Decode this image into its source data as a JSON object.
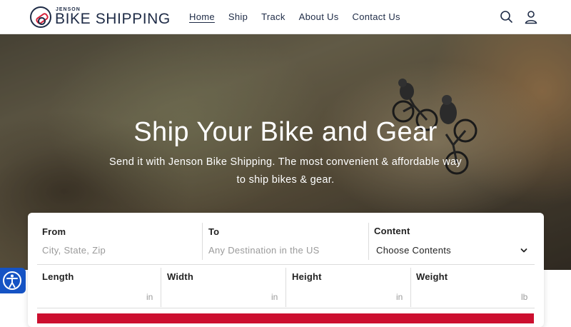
{
  "header": {
    "logo_small": "JENSON",
    "logo_big": "BIKE SHIPPING",
    "nav": [
      {
        "label": "Home",
        "active": true
      },
      {
        "label": "Ship"
      },
      {
        "label": "Track"
      },
      {
        "label": "About Us"
      },
      {
        "label": "Contact Us"
      }
    ],
    "icons": [
      "search-icon",
      "account-icon"
    ]
  },
  "hero": {
    "title": "Ship Your Bike and Gear",
    "subtitle": "Send it with Jenson Bike Shipping. The most convenient & affordable way to ship bikes & gear."
  },
  "form": {
    "from": {
      "label": "From",
      "placeholder": "City, State, Zip"
    },
    "to": {
      "label": "To",
      "placeholder": "Any Destination in the US"
    },
    "content": {
      "label": "Content",
      "selected": "Choose Contents"
    },
    "length": {
      "label": "Length",
      "unit": "in"
    },
    "width": {
      "label": "Width",
      "unit": "in"
    },
    "height": {
      "label": "Height",
      "unit": "in"
    },
    "weight": {
      "label": "Weight",
      "unit": "lb"
    }
  },
  "colors": {
    "brand_navy": "#1e2b46",
    "brand_red": "#d6213a",
    "submit": "#cc0f2f",
    "accessibility": "#1553c4"
  }
}
